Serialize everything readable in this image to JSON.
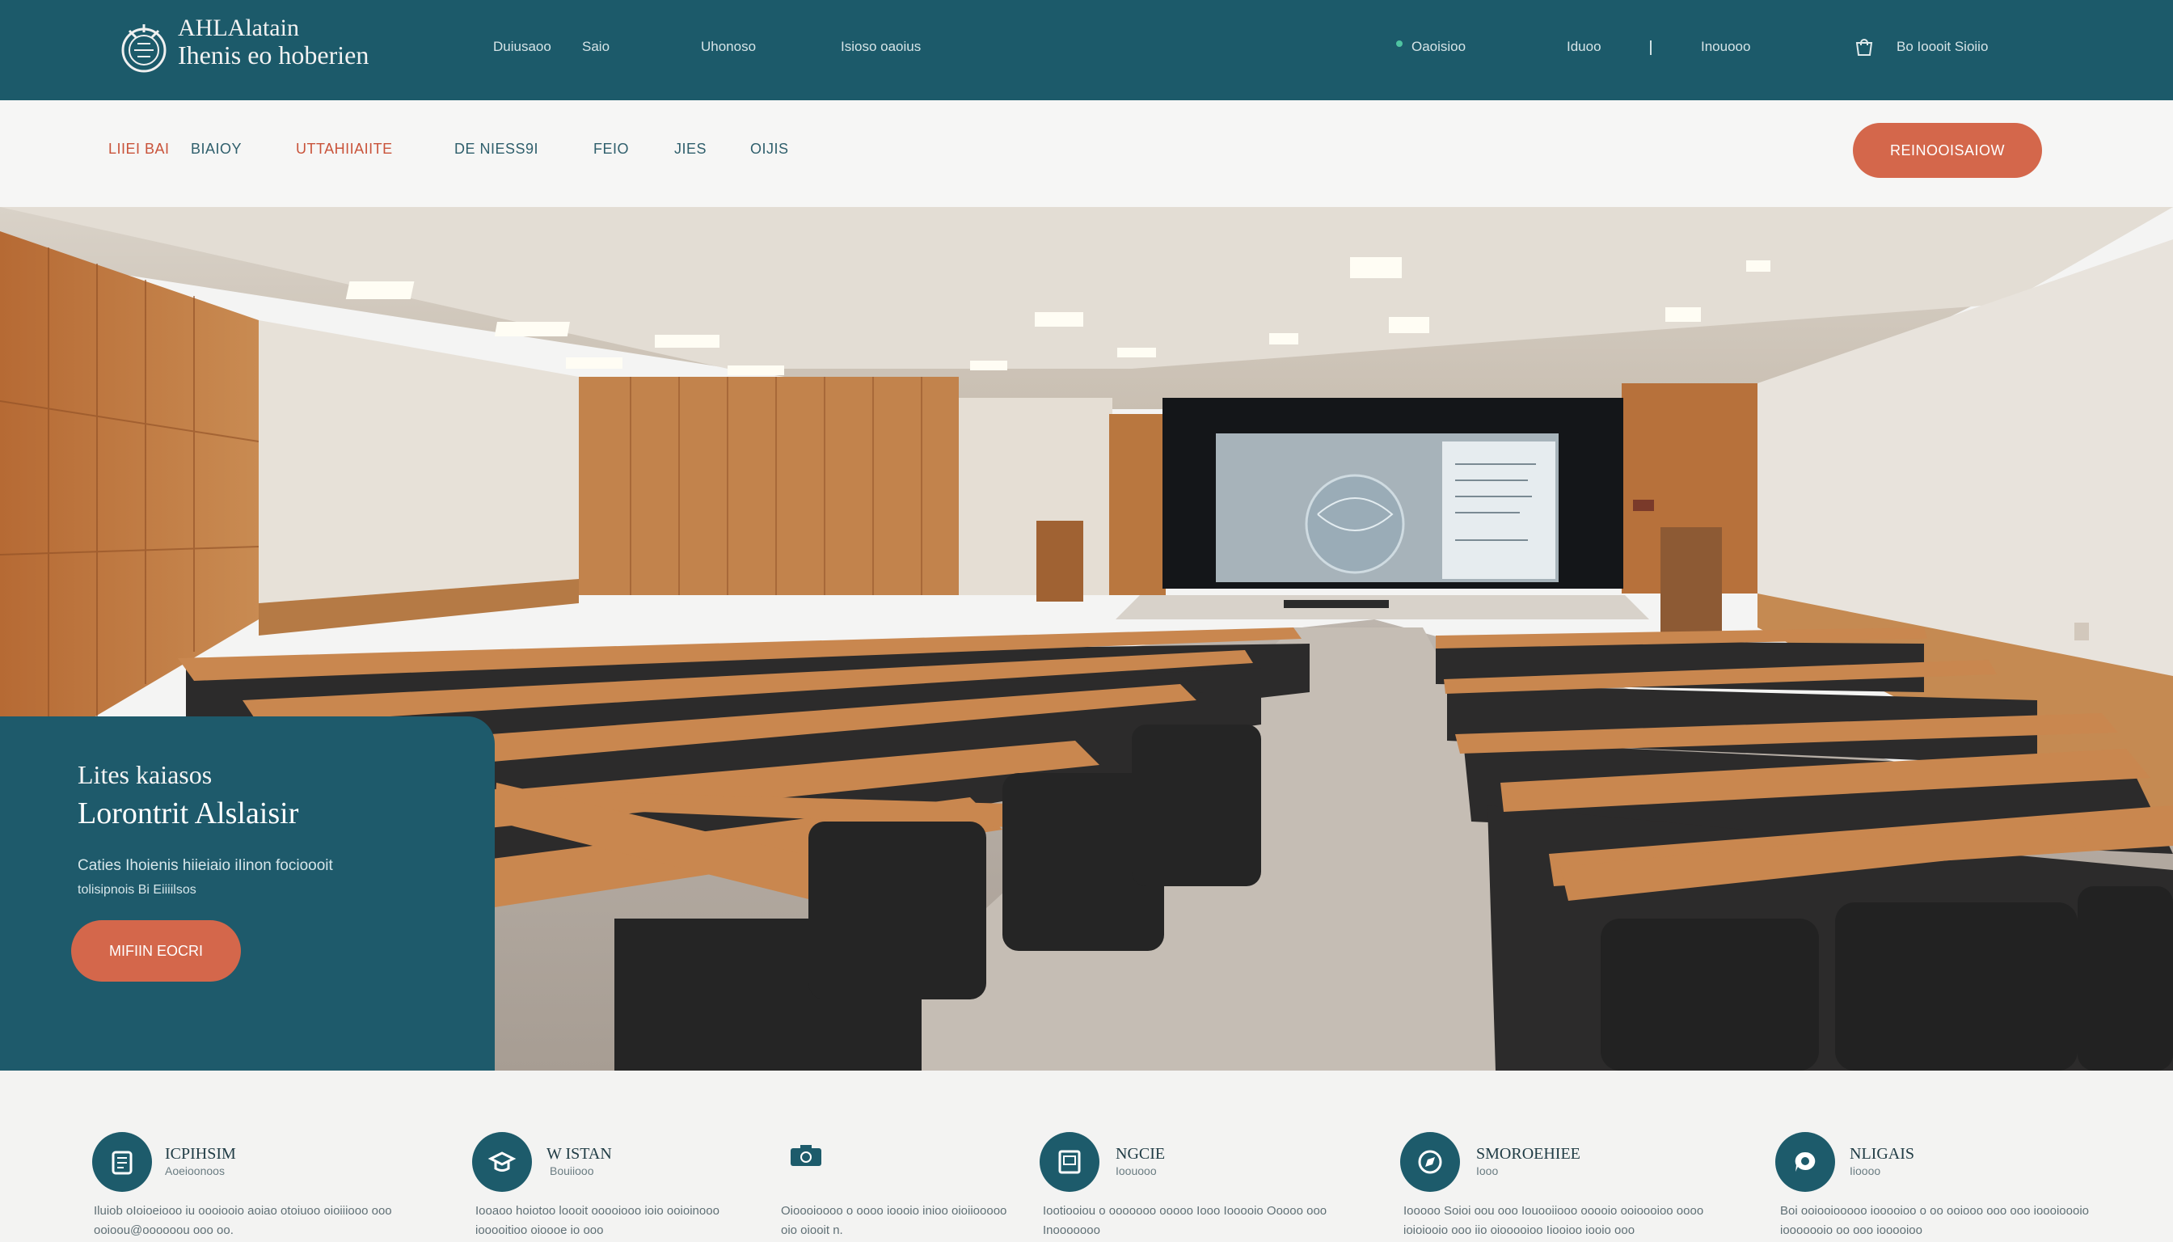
{
  "header": {
    "logo_line1": "AHLAlatain",
    "logo_line2": "Ihenis eo hoberien",
    "utility_links": [
      "Duiusaoo",
      "Saio",
      "Uhonoso",
      "Isioso oaoius"
    ],
    "status_text": "Oaoisioo",
    "account_text": "Iduoo",
    "contact_text": "Inouooo",
    "cart_text": "Bo Ioooit Sioiio"
  },
  "nav": {
    "items": [
      "LIIEI BAI",
      "BIAIOY",
      "UTTAHIIAIITE",
      "DE NIESS9I",
      "FEIO",
      "JIES",
      "OIJIS"
    ],
    "active_index": 0,
    "active_second_index": 2,
    "cta_label": "REINOOISAIOW"
  },
  "hero": {
    "kicker": "Lites kaiasos",
    "title": "Lorontrit Alslaisir",
    "description_line1": "Caties Ihoienis hiieiaio iIinon focioooit",
    "description_line2": "tolisipnois Bi Eiiiilsos",
    "button_label": "MIFIIN EOCRI"
  },
  "features": [
    {
      "title": "ICPIHSIM",
      "subtitle": "Aoeioonoos",
      "text": "Iluiob oIoioeiooo iu oooiooio aoiao otoiuoo oioiiiooo ooo",
      "text2": "ooioou@oooooou ooo oo."
    },
    {
      "title": "W ISTAN",
      "subtitle": "Bouiiooo",
      "text": "Iooaoo hoiotoo loooit ooooiooo ioio ooioinooo",
      "text2": "iooooitioo oioooe io ooo"
    },
    {
      "title": "",
      "subtitle": "",
      "text": "Oioooioooo o oooo ioooio  inioo oioiiooooo",
      "text2": "oio oiooit n."
    },
    {
      "title": "NGCIE",
      "subtitle": "Ioouooo",
      "text": "Iootiooiou o ooooooo ooooo Iooo Iooooio Ooooo ooo",
      "text2": "Inooooooo"
    },
    {
      "title": "SMOROEHIEE",
      "subtitle": "Iooo",
      "text": "Iooooo Soioi oou ooo Iouooiiooo ooooio ooioooioo oooo",
      "text2": "ioioiooio ooo iio oiooooioo Iiooioo iooio ooo"
    },
    {
      "title": "NLIGAIS",
      "subtitle": "Iioooo",
      "text": "Boi ooiooiooooo iooooioo o oo ooiooo ooo ooo ioooioooio",
      "text2": "iooooooio oo ooo iooooioo"
    }
  ],
  "icons": {
    "logo": "university-seal-icon",
    "cart": "shopping-bag-icon",
    "feature_icons": [
      "book-icon",
      "graduation-cap-icon",
      "camera-icon",
      "document-icon",
      "compass-icon",
      "chat-bubble-icon"
    ]
  },
  "colors": {
    "primary_teal": "#1c5a6a",
    "accent_orange": "#d4674b",
    "active_nav": "#c9533a"
  }
}
